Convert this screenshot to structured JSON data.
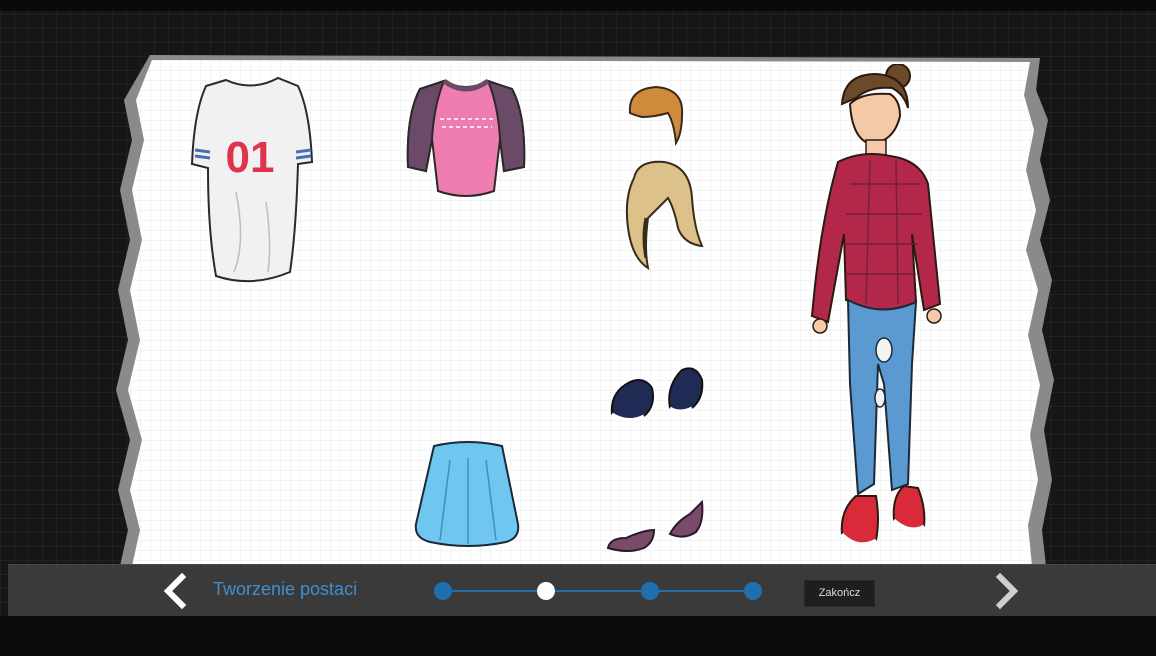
{
  "footer": {
    "step_title": "Tworzenie postaci",
    "finish_label": "Zakończ",
    "progress": {
      "steps": 4,
      "current": 2
    }
  },
  "shirt_number": "01",
  "icons": {
    "prev": "chevron-left-icon",
    "next": "chevron-right-icon"
  },
  "colors": {
    "accent": "#1f6fae",
    "title": "#3f8fd0",
    "bar": "#3a3a3a"
  }
}
